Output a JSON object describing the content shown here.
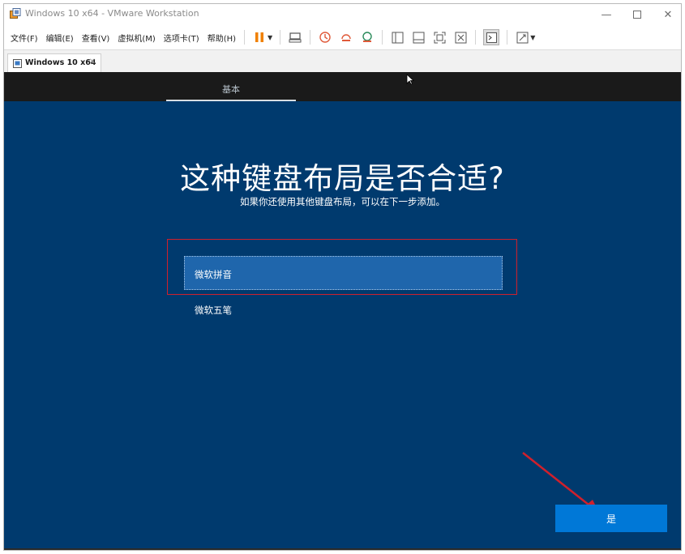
{
  "window": {
    "title": "Windows 10 x64 - VMware Workstation"
  },
  "menubar": {
    "items": [
      "文件(F)",
      "编辑(E)",
      "查看(V)",
      "虚拟机(M)",
      "选项卡(T)",
      "帮助(H)"
    ]
  },
  "toolbar": {
    "icons": [
      "pause-icon",
      "send-keys-icon",
      "snapshot-icon",
      "revert-snapshot-icon",
      "snapshot-manager-icon",
      "sidebar-icon",
      "thumbnail-icon",
      "fullscreen-icon",
      "unity-icon",
      "console-icon",
      "stretch-icon"
    ]
  },
  "tabs": [
    {
      "label": "Windows 10 x64"
    }
  ],
  "vm": {
    "section_tab": "基本",
    "heading": "这种键盘布局是否合适?",
    "subheading": "如果你还使用其他键盘布局，可以在下一步添加。",
    "options": [
      {
        "label": "微软拼音",
        "selected": true
      },
      {
        "label": "微软五笔",
        "selected": false
      }
    ],
    "confirm_button": "是"
  },
  "colors": {
    "vm_background": "#003a6e",
    "selected_option": "#1f66ac",
    "primary_button": "#0078d7",
    "annotation_red": "#d0202c",
    "pause_orange": "#f08000"
  }
}
